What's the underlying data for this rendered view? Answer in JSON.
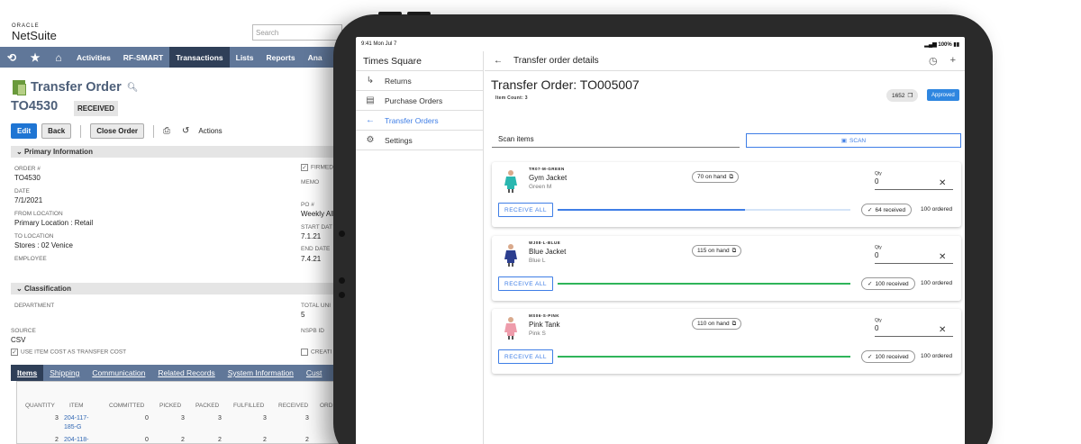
{
  "netsuite": {
    "logo_top": "ORACLE",
    "logo_bottom": "NetSuite",
    "search_placeholder": "Search",
    "nav": [
      "Activities",
      "RF-SMART",
      "Transactions",
      "Lists",
      "Reports",
      "Ana"
    ],
    "nav_active": "Transactions",
    "title": "Transfer Order",
    "record_id": "TO4530",
    "status": "RECEIVED",
    "buttons": {
      "edit": "Edit",
      "back": "Back",
      "close": "Close Order",
      "actions": "Actions"
    },
    "primary_header": "Primary Information",
    "fields": {
      "order_label": "ORDER #",
      "order_value": "TO4530",
      "date_label": "DATE",
      "date_value": "7/1/2021",
      "from_label": "FROM LOCATION",
      "from_value": "Primary Location : Retail",
      "to_label": "TO LOCATION",
      "to_value": "Stores : 02 Venice",
      "employee_label": "EMPLOYEE",
      "firmed_label": "FIRMED",
      "memo_label": "MEMO",
      "po_label": "PO #",
      "po_value": "Weekly All",
      "start_label": "START DAT",
      "start_value": "7.1.21",
      "end_label": "END DATE",
      "end_value": "7.4.21"
    },
    "classification_header": "Classification",
    "class_fields": {
      "department_label": "DEPARTMENT",
      "total_label": "TOTAL UNI",
      "total_value": "5",
      "source_label": "SOURCE",
      "source_value": "CSV",
      "nspb_label": "NSPB ID",
      "use_item_cost": "USE ITEM COST AS TRANSFER COST",
      "create_label": "CREATI"
    },
    "tabs": [
      "Items",
      "Shipping",
      "Communication",
      "Related Records",
      "System Information",
      "Cust"
    ],
    "table": {
      "headers": [
        "QUANTITY",
        "ITEM",
        "COMMITTED",
        "PICKED",
        "PACKED",
        "FULFILLED",
        "RECEIVED",
        "ORD"
      ],
      "rows": [
        {
          "qty": "3",
          "item": "204-117-",
          "item2": "185-G",
          "committed": "0",
          "picked": "3",
          "packed": "3",
          "fulfilled": "3",
          "received": "3"
        },
        {
          "qty": "2",
          "item": "204-118-",
          "item2": "",
          "committed": "0",
          "picked": "2",
          "packed": "2",
          "fulfilled": "2",
          "received": "2"
        }
      ]
    }
  },
  "tablet": {
    "status_time": "9:41  Mon Jul 7",
    "status_right": "100%",
    "store": "Times Square",
    "menu": [
      {
        "label": "Returns",
        "icon": "returns-icon"
      },
      {
        "label": "Purchase Orders",
        "icon": "purchase-orders-icon"
      },
      {
        "label": "Transfer Orders",
        "icon": "arrow-left-icon"
      },
      {
        "label": "Settings",
        "icon": "gear-icon"
      }
    ],
    "menu_selected": "Transfer Orders",
    "header_title": "Transfer order details",
    "order_title": "Transfer Order: TO005007",
    "item_count": "Item Count: 3",
    "count_pill": "1652",
    "approved": "Approved",
    "scan_label": "Scan items",
    "scan_button": "SCAN",
    "qty_label": "Qty",
    "receive_all": "RECEIVE ALL",
    "items": [
      {
        "sku": "TR07-M-GREEN",
        "name": "Gym Jacket",
        "variant": "Green M",
        "on_hand": "70 on hand",
        "qty": "0",
        "received": "64 received",
        "ordered": "100 ordered",
        "progress": 0.64,
        "bar_color": "#3f7ee6",
        "thumb_color": "#2ab7b0"
      },
      {
        "sku": "WJ08-L-BLUE",
        "name": "Blue Jacket",
        "variant": "Blue L",
        "on_hand": "115 on hand",
        "qty": "0",
        "received": "100 received",
        "ordered": "100 ordered",
        "progress": 1.0,
        "bar_color": "#2fb55a",
        "thumb_color": "#2c3e8f"
      },
      {
        "sku": "MS06-S-PINK",
        "name": "Pink Tank",
        "variant": "Pink S",
        "on_hand": "110 on hand",
        "qty": "0",
        "received": "100 received",
        "ordered": "100 ordered",
        "progress": 1.0,
        "bar_color": "#2fb55a",
        "thumb_color": "#ee9cab"
      }
    ]
  }
}
